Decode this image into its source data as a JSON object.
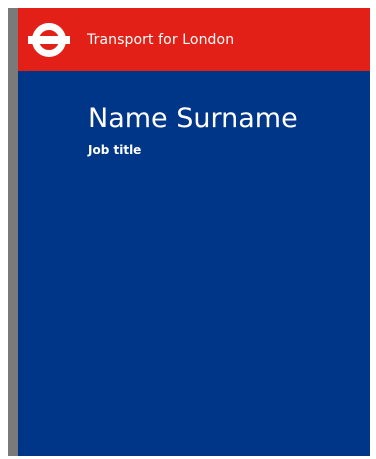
{
  "header": {
    "brand": "Transport for London",
    "logo_icon": "tfl-roundel-icon"
  },
  "card": {
    "name": "Name Surname",
    "job_title": "Job title"
  },
  "colors": {
    "header_red": "#e32017",
    "body_blue": "#003688",
    "edge_gray": "#7a7a7a",
    "text_white": "#ffffff"
  }
}
